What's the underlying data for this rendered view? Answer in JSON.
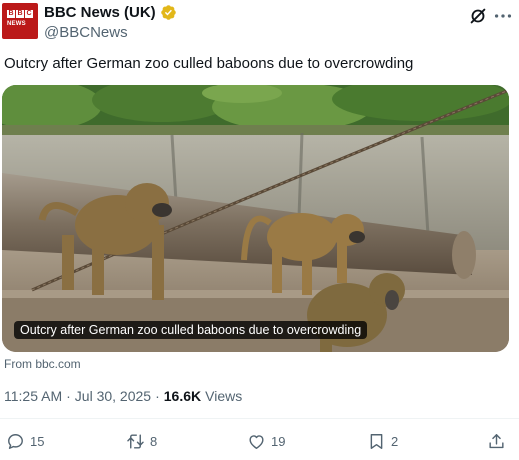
{
  "account": {
    "name": "BBC News (UK)",
    "handle": "@BBCNews",
    "avatar_letters": [
      "B",
      "B",
      "C"
    ],
    "avatar_word": "NEWS",
    "brand_color": "#bb1919",
    "verified_color": "#e2b719"
  },
  "tweet": {
    "text": "Outcry after German zoo culled baboons due to overcrowding"
  },
  "card": {
    "caption": "Outcry after German zoo culled baboons due to overcrowding",
    "source": "From bbc.com"
  },
  "meta": {
    "time": "11:25 AM",
    "date": "Jul 30, 2025",
    "views_count": "16.6K",
    "views_label": "Views"
  },
  "actions": {
    "reply_count": "15",
    "repost_count": "8",
    "like_count": "19",
    "bookmark_count": "2"
  },
  "icons": {
    "grok": "grok-icon",
    "more": "more-icon",
    "reply": "reply-icon",
    "repost": "repost-icon",
    "like": "like-icon",
    "bookmark": "bookmark-icon",
    "share": "share-icon"
  }
}
